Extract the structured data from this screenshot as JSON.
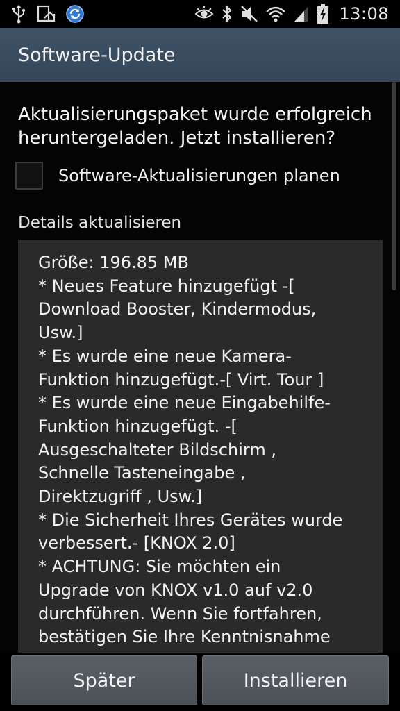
{
  "status_bar": {
    "left_icons": [
      "usb-icon",
      "screenshot-icon",
      "sync-icon"
    ],
    "right_icons": [
      "smart-stay-eye-icon",
      "bluetooth-icon",
      "muted-icon",
      "wifi-icon",
      "signal-icon",
      "battery-charging-icon"
    ],
    "time": "13:08"
  },
  "action_bar": {
    "title": "Software-Update",
    "color": "#3a4c60"
  },
  "dialog": {
    "message": "Aktualisierungspaket wurde erfolgreich heruntergeladen. Jetzt installieren?",
    "schedule_checkbox": {
      "label": "Software-Aktualisierungen planen",
      "checked": false
    },
    "details_label": "Details aktualisieren",
    "details_text": "Größe: 196.85 MB\n* Neues Feature hinzugefügt -[\nDownload Booster, Kindermodus,\nUsw.]\n* Es wurde eine neue Kamera-\nFunktion hinzugefügt.-[ Virt. Tour ]\n* Es wurde eine neue Eingabehilfe-\nFunktion hinzugefügt. -[\nAusgeschalteter Bildschirm ,\nSchnelle Tasteneingabe ,\nDirektzugriff , Usw.]\n* Die Sicherheit Ihres Gerätes wurde\nverbessert.- [KNOX 2.0]\n* ACHTUNG: Sie möchten ein\nUpgrade von KNOX v1.0 auf v2.0\ndurchführen. Wenn Sie fortfahren,\nbestätigen Sie Ihre Kenntnisnahme"
  },
  "buttons": {
    "later": "Später",
    "install": "Installieren"
  }
}
